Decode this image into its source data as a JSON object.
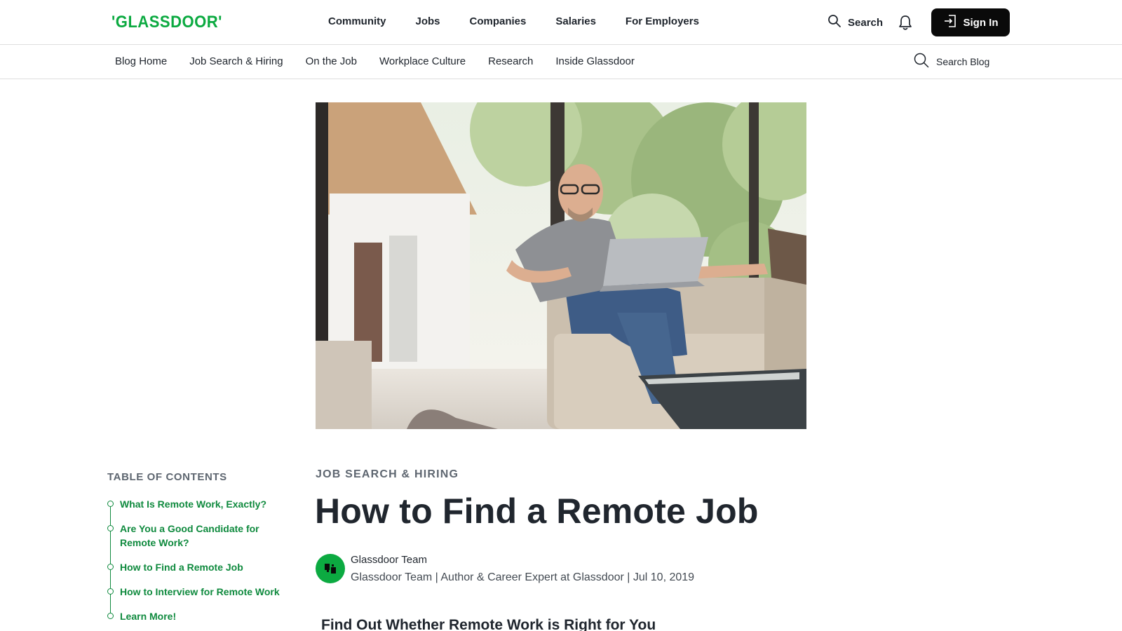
{
  "brand": {
    "logo_text": "'GLASSDOOR'",
    "accent": "#0caa41"
  },
  "top_nav": {
    "items": [
      "Community",
      "Jobs",
      "Companies",
      "Salaries",
      "For Employers"
    ],
    "search_label": "Search",
    "signin_label": "Sign In"
  },
  "sub_nav": {
    "items": [
      "Blog Home",
      "Job Search & Hiring",
      "On the Job",
      "Workplace Culture",
      "Research",
      "Inside Glassdoor"
    ],
    "search_label": "Search Blog"
  },
  "toc": {
    "title": "TABLE OF CONTENTS",
    "items": [
      "What Is Remote Work, Exactly?",
      "Are You a Good Candidate for Remote Work?",
      "How to Find a Remote Job",
      "How to Interview for Remote Work",
      "Learn More!"
    ],
    "color": "#0f8a3e"
  },
  "article": {
    "category": "JOB SEARCH & HIRING",
    "title": "How to Find a Remote Job",
    "author_name": "Glassdoor Team",
    "byline": "Glassdoor Team | Author & Career Expert at Glassdoor | Jul 10, 2019",
    "subheading": "Find Out Whether Remote Work is Right for You"
  },
  "hero": {
    "description_icon": "man-with-laptop-photo"
  }
}
